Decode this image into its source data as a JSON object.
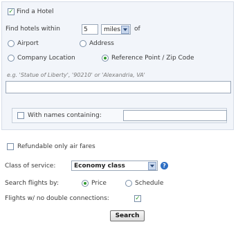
{
  "hotel": {
    "find_hotel_label": "Find a Hotel",
    "find_hotel_checked": true,
    "find_within_label": "Find hotels within",
    "distance_value": "5",
    "distance_unit": "miles",
    "of_label": "of",
    "location_options": [
      {
        "label": "Airport",
        "selected": false
      },
      {
        "label": "Address",
        "selected": false
      },
      {
        "label": "Company Location",
        "selected": false
      },
      {
        "label": "Reference Point / Zip Code",
        "selected": true
      }
    ],
    "reference_hint": "e.g. 'Statue of Liberty', '90210' or 'Alexandria, VA'",
    "reference_value": "",
    "names_label": "With names containing:",
    "names_checked": false,
    "names_value": ""
  },
  "flights": {
    "refundable_label": "Refundable only air fares",
    "refundable_checked": false,
    "class_label": "Class of service:",
    "class_value": "Economy class",
    "search_by_label": "Search flights by:",
    "search_by_options": [
      {
        "label": "Price",
        "selected": true
      },
      {
        "label": "Schedule",
        "selected": false
      }
    ],
    "no_double_label": "Flights w/ no double connections:",
    "no_double_checked": true
  },
  "search_button": "Search",
  "colors": {
    "accent_green": "#2f9a2f",
    "panel_bg": "#f2f5fa",
    "help_blue": "#2e6fc4"
  }
}
